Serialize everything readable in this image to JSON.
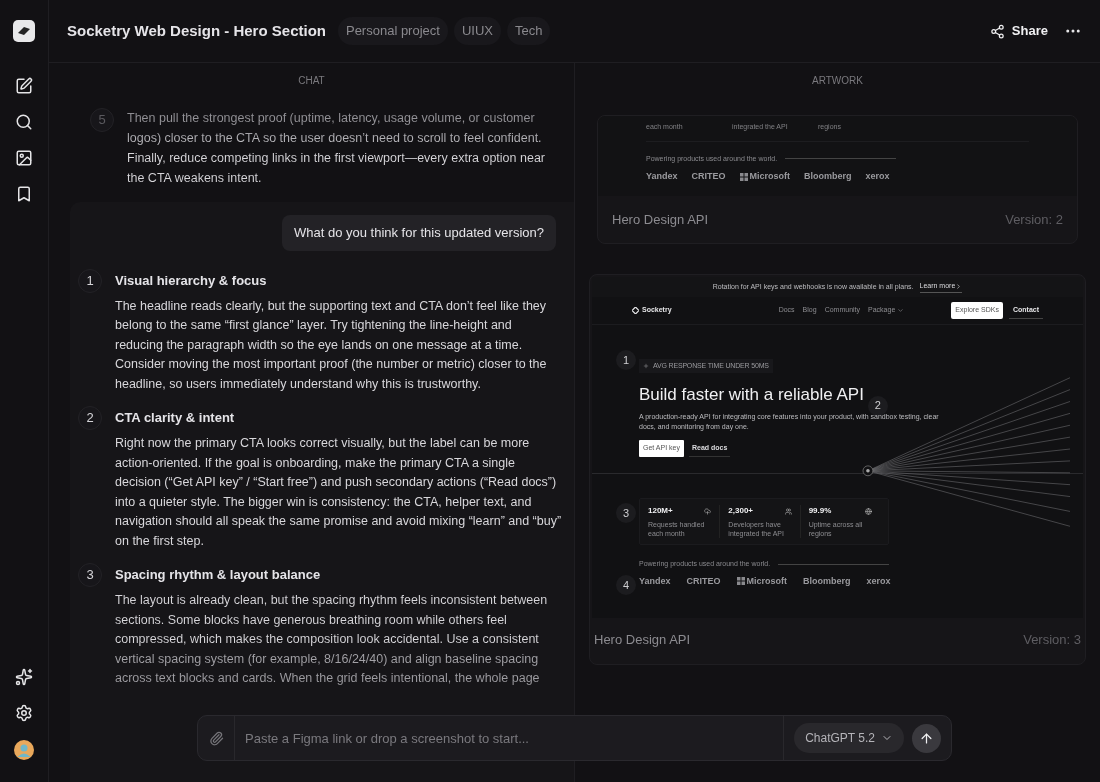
{
  "header": {
    "title": "Socketry Web Design - Hero Section",
    "tags": [
      "Personal project",
      "UIUX",
      "Tech"
    ],
    "share": "Share"
  },
  "chat": {
    "label": "CHAT",
    "previous_item": {
      "number": "5",
      "text": "Then pull the strongest proof (uptime, latency, usage volume, or customer logos) closer to the CTA so the user doesn’t need to scroll to feel confident. Finally, reduce competing links in the first viewport—every extra option near the CTA weakens intent."
    },
    "user_message": "What do you think for this updated version?",
    "items": [
      {
        "number": "1",
        "title": "Visual hierarchy & focus",
        "text": "The headline reads clearly, but the supporting text and CTA don’t feel like they belong to the same “first glance” layer. Try tightening the line-height and reducing the paragraph width so the eye lands on one message at a time. Consider moving the most important proof (the number or metric) closer to the headline, so users immediately understand why this is trustworthy."
      },
      {
        "number": "2",
        "title": "CTA clarity & intent",
        "text": "Right now the primary CTA looks correct visually, but the label can be more action-oriented. If the goal is onboarding, make the primary CTA a single decision (“Get API key” / “Start free”) and push secondary actions (“Read docs”) into a quieter style. The bigger win is consistency: the CTA, helper text, and navigation should all speak the same promise and avoid mixing “learn” and “buy” on the first step."
      },
      {
        "number": "3",
        "title": "Spacing rhythm & layout balance",
        "text": "The layout is already clean, but the spacing rhythm feels inconsistent between sections. Some blocks have generous breathing room while others feel compressed, which makes the composition look accidental. Use a consistent vertical spacing system (for example, 8/16/24/40) and align baseline spacing across text blocks and cards. When the grid feels intentional, the whole page"
      }
    ],
    "input": {
      "placeholder": "Paste a Figma link or drop a screenshot to start...",
      "model": "ChatGPT 5.2"
    }
  },
  "artwork": {
    "label": "ARTWORK",
    "cards": [
      {
        "kind": "partial",
        "title": "Hero Design API",
        "version": "Version: 2",
        "preview": {
          "stat_captions": [
            "each month",
            "integrated the API",
            "regions"
          ],
          "logos_caption": "Powering products used around the world.",
          "logos": [
            "Yandex",
            "CRITEO",
            "Microsoft",
            "Bloomberg",
            "xerox"
          ]
        }
      },
      {
        "kind": "full",
        "title": "Hero Design API",
        "version": "Version: 3",
        "preview": {
          "banner": "Rotation for API keys and webhooks is now available in all plans.",
          "banner_link": "Learn more",
          "brand": "Socketry",
          "nav": [
            "Docs",
            "Blog",
            "Community",
            "Package"
          ],
          "nav_buttons": [
            "Explore SDKs",
            "Contact"
          ],
          "badge": "AVG RESPONSE TIME UNDER 50MS",
          "headline": "Build faster with a reliable API",
          "subtext": "A production-ready API for integrating core features into your product, with sandbox testing, clear docs, and monitoring from day one.",
          "buttons": [
            "Get API key",
            "Read docs"
          ],
          "stats": [
            {
              "value": "120M+",
              "label": "Requests handled each month"
            },
            {
              "value": "2,300+",
              "label": "Developers have integrated the API"
            },
            {
              "value": "99.9%",
              "label": "Uptime across all regions"
            }
          ],
          "logos_caption": "Powering products used around the world.",
          "logos": [
            "Yandex",
            "CRITEO",
            "Microsoft",
            "Bloomberg",
            "xerox"
          ],
          "markers": [
            "1",
            "2",
            "3",
            "4"
          ]
        }
      }
    ]
  }
}
